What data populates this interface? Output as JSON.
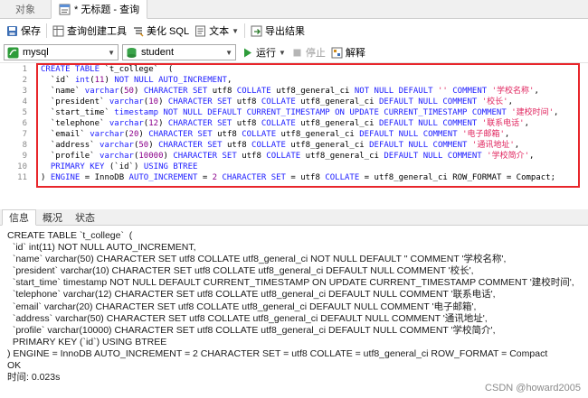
{
  "tabs": {
    "object_label": "对象",
    "active_label": "* 无标题 - 查询"
  },
  "toolbar1": {
    "save": "保存",
    "query_builder": "查询创建工具",
    "beautify": "美化 SQL",
    "text": "文本",
    "export": "导出结果"
  },
  "toolbar2": {
    "connection": "mysql",
    "database": "student",
    "run": "运行",
    "stop": "停止",
    "explain": "解释"
  },
  "editor": {
    "line_numbers": [
      "1",
      "2",
      "3",
      "4",
      "5",
      "6",
      "7",
      "8",
      "9",
      "10",
      "11"
    ]
  },
  "panel": {
    "tabs": [
      "信息",
      "概况",
      "状态"
    ],
    "info_lines": [
      "CREATE TABLE `t_college`  (",
      "  `id` int(11) NOT NULL AUTO_INCREMENT,",
      "  `name` varchar(50) CHARACTER SET utf8 COLLATE utf8_general_ci NOT NULL DEFAULT '' COMMENT '学校名称',",
      "  `president` varchar(10) CHARACTER SET utf8 COLLATE utf8_general_ci DEFAULT NULL COMMENT '校长',",
      "  `start_time` timestamp NOT NULL DEFAULT CURRENT_TIMESTAMP ON UPDATE CURRENT_TIMESTAMP COMMENT '建校时间',",
      "  `telephone` varchar(12) CHARACTER SET utf8 COLLATE utf8_general_ci DEFAULT NULL COMMENT '联系电话',",
      "  `email` varchar(20) CHARACTER SET utf8 COLLATE utf8_general_ci DEFAULT NULL COMMENT '电子邮箱',",
      "  `address` varchar(50) CHARACTER SET utf8 COLLATE utf8_general_ci DEFAULT NULL COMMENT '通讯地址',",
      "  `profile` varchar(10000) CHARACTER SET utf8 COLLATE utf8_general_ci DEFAULT NULL COMMENT '学校简介',",
      "  PRIMARY KEY (`id`) USING BTREE",
      ") ENGINE = InnoDB AUTO_INCREMENT = 2 CHARACTER SET = utf8 COLLATE = utf8_general_ci ROW_FORMAT = Compact",
      "OK",
      "时间: 0.023s"
    ]
  },
  "watermark": "CSDN @howard2005",
  "colors": {
    "keyword": "#1c1cff",
    "string": "#e0245e",
    "number": "#8b008b",
    "highlight_border": "#e8262b"
  }
}
